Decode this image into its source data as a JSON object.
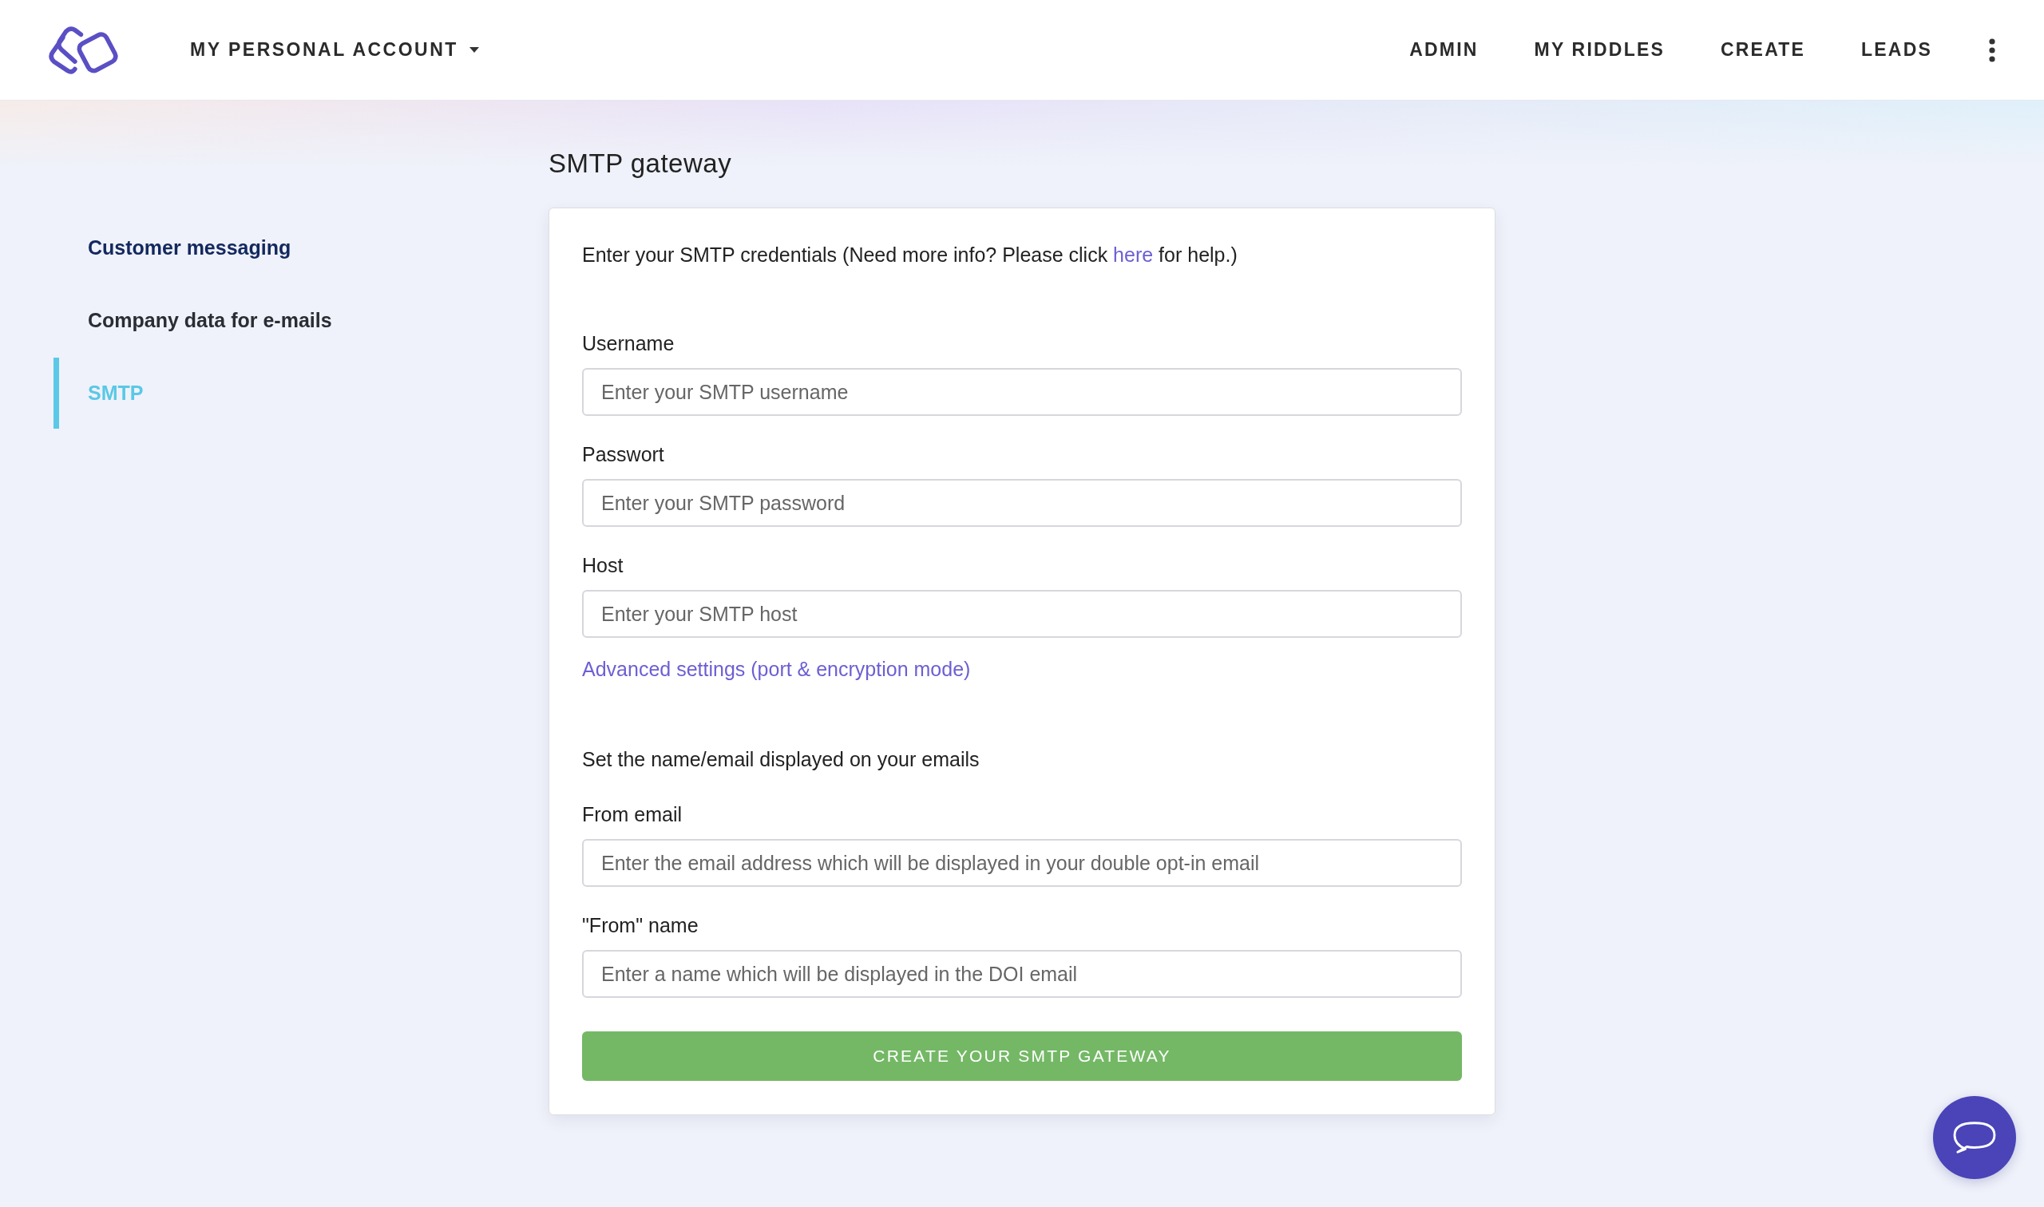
{
  "header": {
    "account_menu": "MY PERSONAL ACCOUNT",
    "nav": [
      "ADMIN",
      "MY RIDDLES",
      "CREATE",
      "LEADS"
    ]
  },
  "sidebar": {
    "items": [
      {
        "label": "Customer messaging",
        "kind": "heading",
        "selected": false
      },
      {
        "label": "Company data for e-mails",
        "kind": "link",
        "selected": false
      },
      {
        "label": "SMTP",
        "kind": "link",
        "selected": true
      }
    ]
  },
  "page_title": "SMTP gateway",
  "form": {
    "intro": {
      "before": "Enter your SMTP credentials (Need more info? Please click ",
      "link": "here",
      "after": " for help.)"
    },
    "credential_fields": [
      {
        "label": "Username",
        "placeholder": "Enter your SMTP username"
      },
      {
        "label": "Passwort",
        "placeholder": "Enter your SMTP password"
      },
      {
        "label": "Host",
        "placeholder": "Enter your SMTP host"
      }
    ],
    "advanced_link": "Advanced settings (port & encryption mode)",
    "sender_heading": "Set the name/email displayed on your emails",
    "sender_fields": [
      {
        "label": "From email",
        "placeholder": "Enter the email address which will be displayed in your double opt-in email"
      },
      {
        "label": "\"From\" name",
        "placeholder": "Enter a name which will be displayed in the DOI email"
      }
    ],
    "submit": "CREATE YOUR SMTP GATEWAY"
  }
}
